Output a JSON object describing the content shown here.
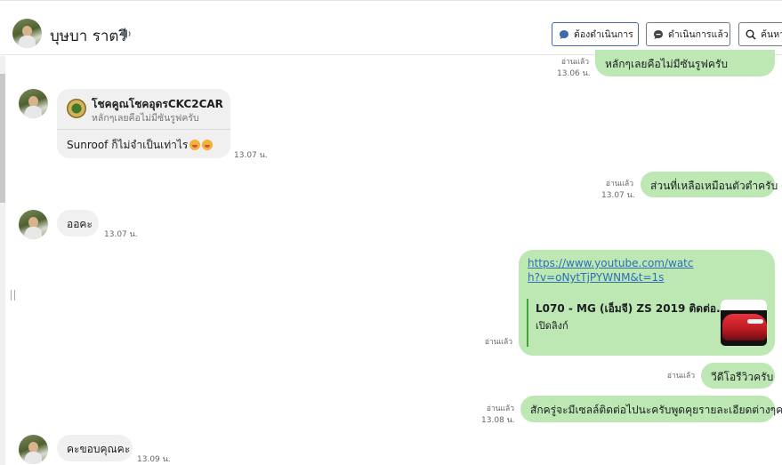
{
  "header": {
    "contact_name": "บุษบา ราตรี",
    "buttons": {
      "todo": "ต้องดำเนินการ",
      "done": "ดำเนินการแล้ว",
      "search": "ค้นหา"
    }
  },
  "messages": {
    "m1": {
      "text": "หลักๆเลยคือไม่มีซันรูฟครับ",
      "read": "อ่านแล้ว",
      "time": "13.06 น."
    },
    "m2": {
      "quote_name": "โชคคูณโชคอุดรCKC2CAR",
      "quote_text": "หลักๆเลยคือไม่มีซันรูฟครับ",
      "text": "Sunroof  ก็ไม่จำเป็นเท่าไร",
      "time": "13.07 น."
    },
    "m3": {
      "text": "ส่วนที่เหลือเหมือนตัวตำครับ",
      "read": "อ่านแล้ว",
      "time": "13.07 น."
    },
    "m4": {
      "text": "ออคะ",
      "time": "13.07 น."
    },
    "m5": {
      "url": "https://www.youtube.com/watch?v=oNytTjPYWNM&t=1s",
      "preview_title": "L070 - MG (เอ็มจี) ZS 2019 ติดต่อ...",
      "preview_sub": "เปิดลิงก์",
      "read": "อ่านแล้ว"
    },
    "m6": {
      "text": "วีดีโอรีวิวครับ",
      "read": "อ่านแล้ว"
    },
    "m7": {
      "text": "สักครู่จะมีเซลล์ติดต่อไปนะครับพูดคุยรายละเอียดต่างๆครับ",
      "read": "อ่านแล้ว",
      "time": "13.08 น."
    },
    "m8": {
      "text": "คะขอบคุณคะ",
      "time": "13.09 น."
    }
  }
}
